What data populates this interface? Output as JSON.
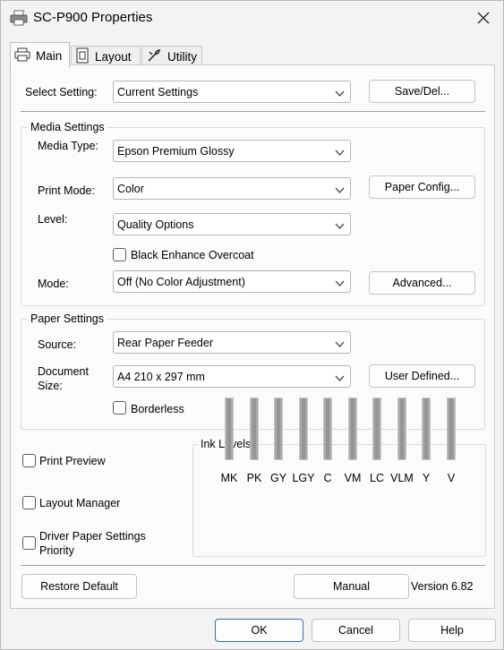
{
  "window": {
    "title": "SC-P900 Properties",
    "icons": {
      "app": "printer-icon",
      "close": "close-icon"
    }
  },
  "tabs": [
    {
      "label": "Main",
      "icon": "printer-icon",
      "active": true
    },
    {
      "label": "Layout",
      "icon": "page-layout-icon",
      "active": false
    },
    {
      "label": "Utility",
      "icon": "wrench-icon",
      "active": false
    }
  ],
  "select_setting": {
    "label": "Select Setting:",
    "value": "Current Settings",
    "button": "Save/Del..."
  },
  "media_settings": {
    "title": "Media Settings",
    "media_type": {
      "label": "Media Type:",
      "value": "Epson Premium Glossy"
    },
    "print_mode": {
      "label": "Print Mode:",
      "value": "Color",
      "button": "Paper Config..."
    },
    "level": {
      "label": "Level:",
      "value": "Quality Options"
    },
    "black_enhance": {
      "label": "Black Enhance Overcoat",
      "checked": false
    },
    "mode": {
      "label": "Mode:",
      "value": "Off (No Color Adjustment)",
      "button": "Advanced..."
    }
  },
  "paper_settings": {
    "title": "Paper Settings",
    "source": {
      "label": "Source:",
      "value": "Rear Paper Feeder"
    },
    "document_size": {
      "label_line1": "Document",
      "label_line2": "Size:",
      "value": "A4 210 x 297 mm",
      "button": "User Defined..."
    },
    "borderless": {
      "label": "Borderless",
      "checked": false
    }
  },
  "options": {
    "print_preview": {
      "label": "Print Preview",
      "checked": false
    },
    "layout_manager": {
      "label": "Layout Manager",
      "checked": false
    },
    "driver_priority": {
      "label_line1": "Driver Paper Settings",
      "label_line2": "Priority",
      "checked": false
    }
  },
  "ink_levels": {
    "title": "Ink Levels",
    "inks": [
      {
        "name": "MK",
        "level": 1.0
      },
      {
        "name": "PK",
        "level": 1.0
      },
      {
        "name": "GY",
        "level": 1.0
      },
      {
        "name": "LGY",
        "level": 1.0
      },
      {
        "name": "C",
        "level": 1.0
      },
      {
        "name": "VM",
        "level": 1.0
      },
      {
        "name": "LC",
        "level": 1.0
      },
      {
        "name": "VLM",
        "level": 1.0
      },
      {
        "name": "Y",
        "level": 1.0
      },
      {
        "name": "V",
        "level": 1.0
      }
    ]
  },
  "bottom": {
    "restore_default": "Restore Default",
    "manual": "Manual",
    "version": "Version 6.82"
  },
  "footer": {
    "ok": "OK",
    "cancel": "Cancel",
    "help": "Help"
  },
  "colors": {
    "primary_border": "#2f6fb6",
    "ink_tube": "#a9a9a9"
  }
}
